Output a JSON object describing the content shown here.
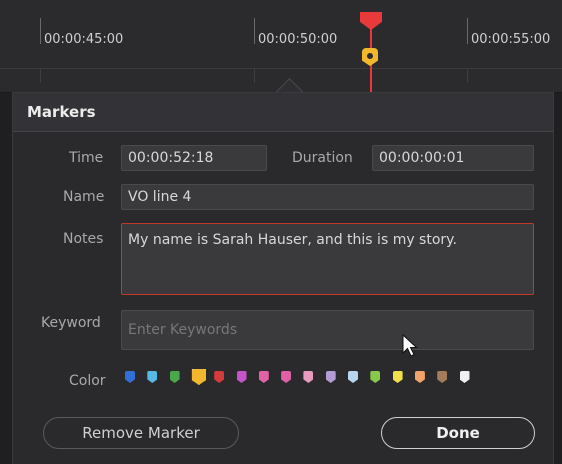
{
  "timeline": {
    "timecodes": [
      "00:00:45:00",
      "00:00:50:00",
      "00:00:55:00"
    ],
    "playhead_color": "#e83a3a",
    "marker_color": "#f1b72d"
  },
  "panel": {
    "title": "Markers",
    "time_label": "Time",
    "time_value": "00:00:52:18",
    "duration_label": "Duration",
    "duration_value": "00:00:00:01",
    "name_label": "Name",
    "name_value": "VO line 4",
    "notes_label": "Notes",
    "notes_value": "My name is Sarah Hauser, and this is my story.",
    "keyword_label": "Keyword",
    "keyword_placeholder": "Enter Keywords",
    "color_label": "Color",
    "colors": [
      "#2f6fd6",
      "#58b8e6",
      "#4aa84a",
      "#f1b72d",
      "#d43b3b",
      "#c455c8",
      "#e262a5",
      "#e060a8",
      "#e89abf",
      "#b39bd3",
      "#b7d6ee",
      "#89c94a",
      "#f2e04a",
      "#f1a36a",
      "#a57c5b",
      "#f0f0f0"
    ],
    "selected_color_index": 3,
    "remove_button": "Remove Marker",
    "done_button": "Done"
  }
}
